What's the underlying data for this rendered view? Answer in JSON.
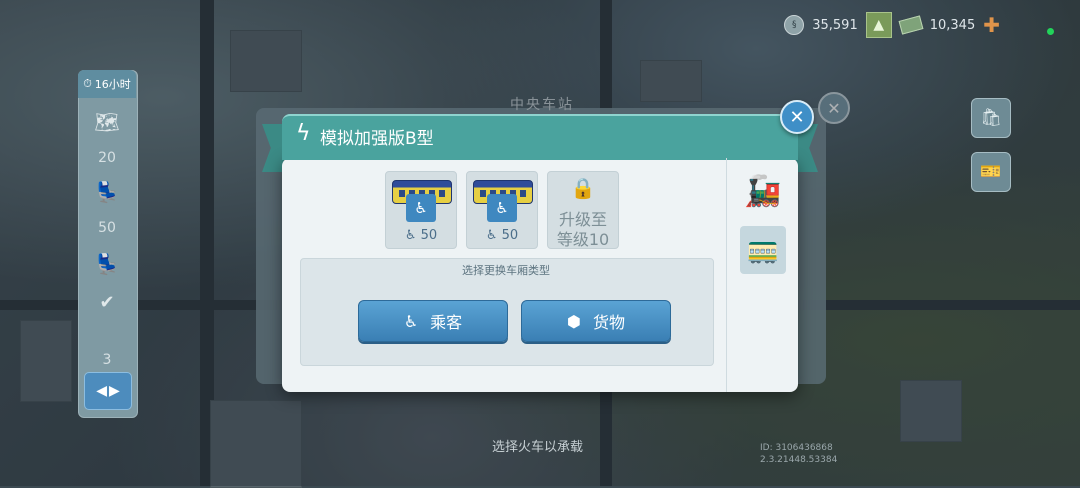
{
  "hud": {
    "simoleons": "35,591",
    "simcash": "10,345"
  },
  "sidebar": {
    "timer_label": "16小时",
    "item1_value": "20",
    "item2_value": "50",
    "page_count": "3"
  },
  "background": {
    "back_title": "中央车站",
    "hint": "选择火车以承载",
    "id_line1": "ID: 3106436868",
    "id_line2": "2.3.21448.53384"
  },
  "dialog": {
    "title": "模拟加强版B型",
    "slots": [
      {
        "capacity": "50"
      },
      {
        "capacity": "50"
      }
    ],
    "locked_line1": "升级至",
    "locked_line2": "等级10",
    "choose_label": "选择更换车厢类型",
    "passenger_label": "乘客",
    "cargo_label": "货物"
  },
  "icons": {
    "close": "close-icon",
    "lightning": "lightning-icon",
    "lock": "lock-icon",
    "engine": "locomotive-icon",
    "car": "train-car-icon",
    "seat": "seat-icon",
    "hexagon": "hexagon-icon"
  },
  "colors": {
    "title_bar": "#4aa39e",
    "button": "#3a7fb4",
    "close_button": "#3f8fc7"
  }
}
